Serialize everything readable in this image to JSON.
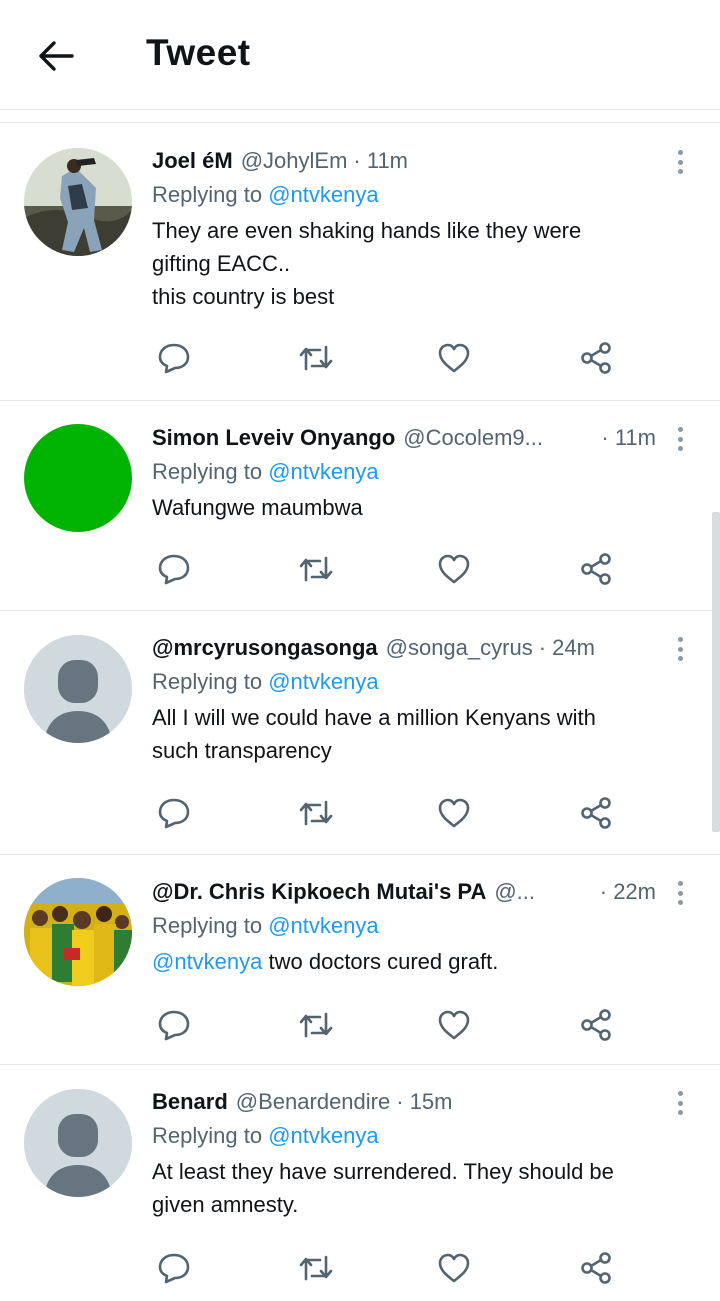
{
  "header": {
    "title": "Tweet",
    "back_icon": "arrow-left-icon"
  },
  "mention_color": "#1d9bf0",
  "tweets": [
    {
      "name": "Joel éM",
      "handle": "@JohylEm",
      "time": "· 11m",
      "replying_prefix": "Replying to ",
      "replying_to": "@ntvkenya",
      "text_lines": [
        "They are even shaking hands like they were",
        "gifting EACC..",
        "this country is best"
      ],
      "avatar": "photo-avatar"
    },
    {
      "name": "Simon Leveiv Onyango",
      "handle": "@Cocolem9...",
      "time": "· 11m",
      "replying_prefix": "Replying to ",
      "replying_to": "@ntvkenya",
      "text_lines": [
        "Wafungwe maumbwa"
      ],
      "avatar": "green-circle-avatar",
      "avatar_color": "#00b300"
    },
    {
      "name": "@mrcyrusongasongа",
      "handle": "@songa_cyrus",
      "time": "· 24m",
      "replying_prefix": "Replying to ",
      "replying_to": "@ntvkenya",
      "text_lines": [
        "All I will we could have a million Kenyans with",
        "such transparency"
      ],
      "avatar": "default-avatar"
    },
    {
      "name": "@Dr. Chris Kipkoech Mutai's PA",
      "handle": "@...",
      "time": "· 22m",
      "replying_prefix": "Replying to ",
      "replying_to": "@ntvkenya",
      "text_mention": "@ntvkenya",
      "text_rest": " two doctors cured graft.",
      "avatar": "photo-avatar-crowd"
    },
    {
      "name": "Benard",
      "handle": "@Benardendire",
      "time": "· 15m",
      "replying_prefix": "Replying to ",
      "replying_to": "@ntvkenya",
      "text_lines": [
        "At least they have surrendered. They should be",
        "given amnesty."
      ],
      "avatar": "default-avatar"
    }
  ]
}
